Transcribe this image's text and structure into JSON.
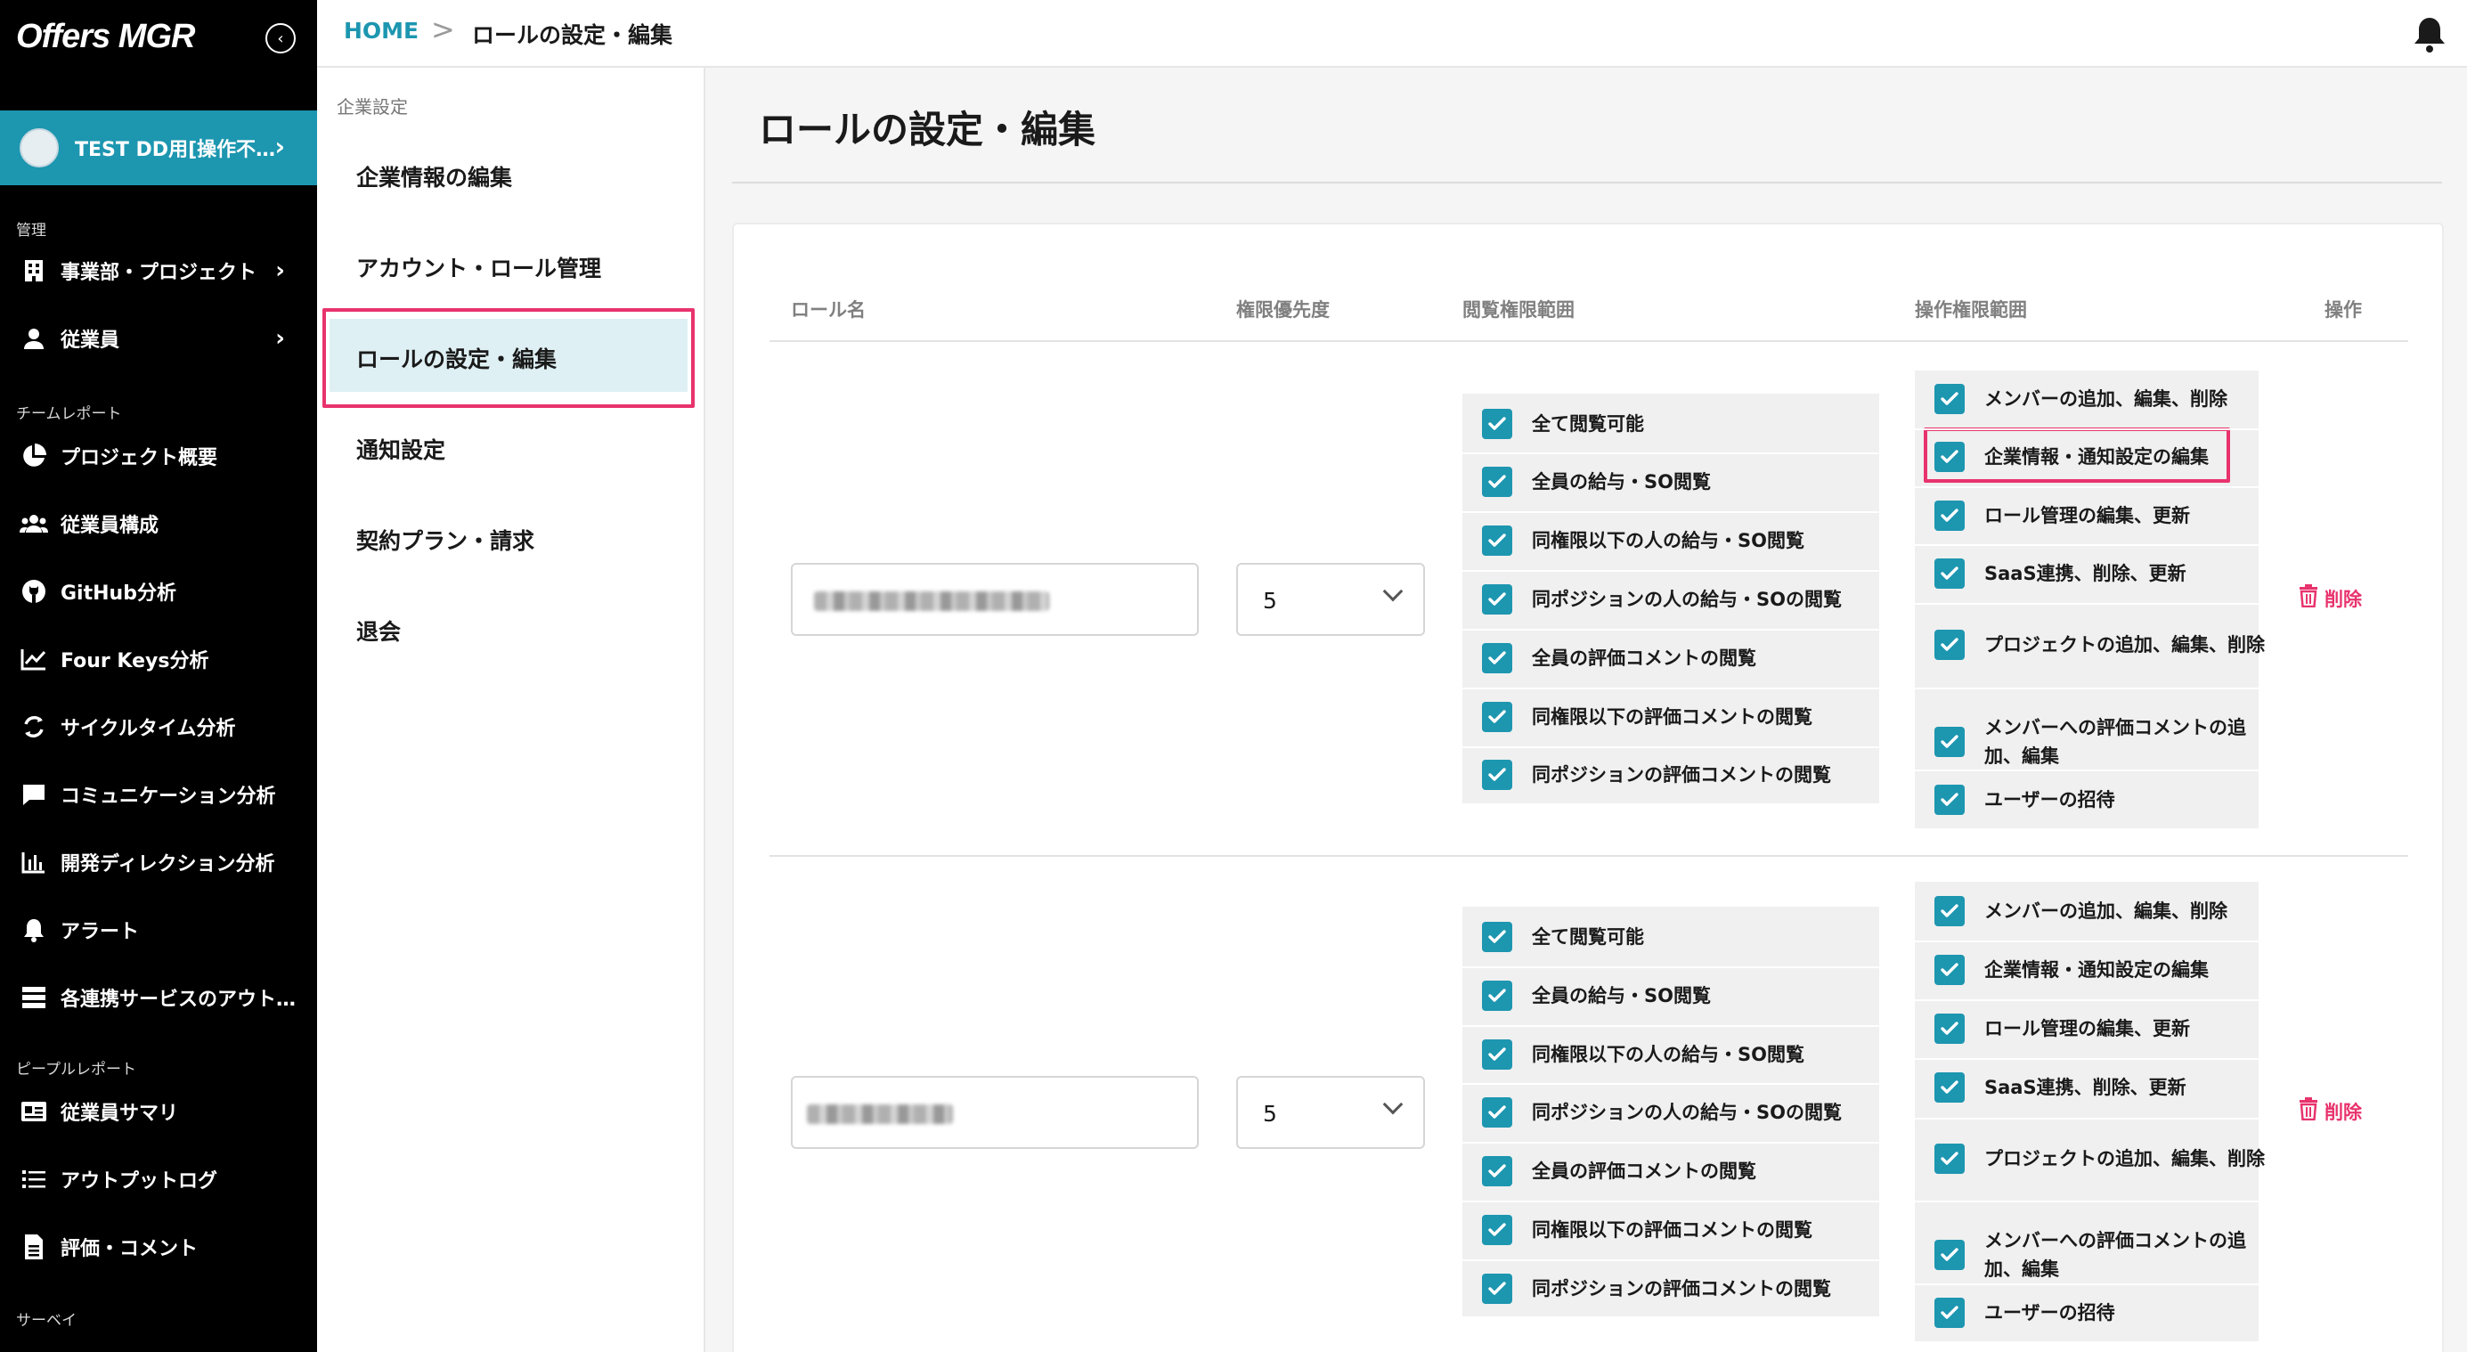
{
  "app": {
    "logo": "Offers MGR"
  },
  "sidebar": {
    "user_name": "TEST DD用[操作不…",
    "sections": {
      "manage": "管理",
      "team_report": "チームレポート",
      "people_report": "ピープルレポート",
      "survey": "サーベイ"
    },
    "items": [
      {
        "label": "事業部・プロジェクト",
        "icon": "building-icon"
      },
      {
        "label": "従業員",
        "icon": "person-icon"
      },
      {
        "label": "プロジェクト概要",
        "icon": "pie-chart-icon"
      },
      {
        "label": "従業員構成",
        "icon": "group-icon"
      },
      {
        "label": "GitHub分析",
        "icon": "github-icon"
      },
      {
        "label": "Four Keys分析",
        "icon": "line-chart-icon"
      },
      {
        "label": "サイクルタイム分析",
        "icon": "cycle-icon"
      },
      {
        "label": "コミュニケーション分析",
        "icon": "chat-icon"
      },
      {
        "label": "開発ディレクション分析",
        "icon": "bar-chart-icon"
      },
      {
        "label": "アラート",
        "icon": "bell-icon"
      },
      {
        "label": "各連携サービスのアウト…",
        "icon": "storage-icon"
      },
      {
        "label": "従業員サマリ",
        "icon": "id-card-icon"
      },
      {
        "label": "アウトプットログ",
        "icon": "list-icon"
      },
      {
        "label": "評価・コメント",
        "icon": "document-icon"
      }
    ]
  },
  "topbar": {
    "home": "HOME",
    "separator": ">",
    "current": "ロールの設定・編集"
  },
  "subnav": {
    "label": "企業設定",
    "items": [
      "企業情報の編集",
      "アカウント・ロール管理",
      "ロールの設定・編集",
      "通知設定",
      "契約プラン・請求",
      "退会"
    ]
  },
  "main": {
    "title": "ロールの設定・編集",
    "columns": {
      "role_name": "ロール名",
      "priority": "権限優先度",
      "view_scope": "閲覧権限範囲",
      "op_scope": "操作権限範囲",
      "action": "操作"
    },
    "view_permissions": [
      "全て閲覧可能",
      "全員の給与・SO閲覧",
      "同権限以下の人の給与・SO閲覧",
      "同ポジションの人の給与・SOの閲覧",
      "全員の評価コメントの閲覧",
      "同権限以下の評価コメントの閲覧",
      "同ポジションの評価コメントの閲覧"
    ],
    "op_permissions": [
      "メンバーの追加、編集、削除",
      "企業情報・通知設定の編集",
      "ロール管理の編集、更新",
      "SaaS連携、削除、更新",
      "プロジェクトの追加、編集、削除",
      "メンバーへの評価コメントの追加、編集",
      "ユーザーの招待"
    ],
    "rows": [
      {
        "priority": "5",
        "delete": "削除"
      },
      {
        "priority": "5",
        "delete": "削除"
      }
    ]
  },
  "colors": {
    "accent": "#1d96b0",
    "highlight": "#e8336d",
    "sidebar_bg": "#000000",
    "active_bg": "#dff0f4"
  }
}
